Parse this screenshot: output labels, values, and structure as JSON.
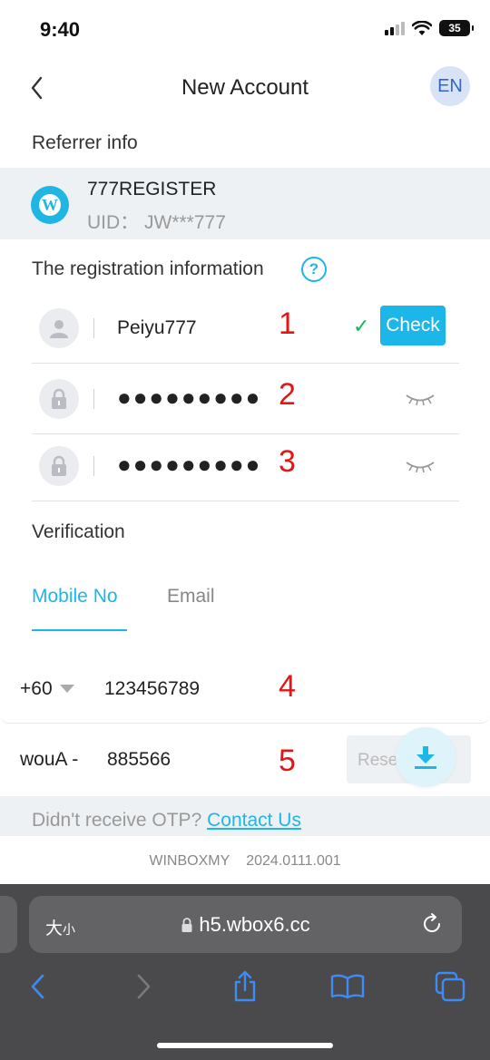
{
  "status_bar": {
    "time": "9:40",
    "battery": "35"
  },
  "header": {
    "title": "New Account",
    "language": "EN"
  },
  "referrer": {
    "section_label": "Referrer info",
    "logo_letter": "W",
    "name": "777REGISTER",
    "uid": "UID： JW***777"
  },
  "registration": {
    "section_label": "The registration information",
    "help_icon": "?",
    "username": {
      "value": "Peiyu777",
      "marker": "1",
      "check_label": "Check"
    },
    "password": {
      "value": "●●●●●●●●●",
      "marker": "2"
    },
    "confirm_password": {
      "value": "●●●●●●●●●",
      "marker": "3"
    }
  },
  "verification": {
    "section_label": "Verification",
    "tabs": [
      {
        "label": "Mobile No",
        "active": true
      },
      {
        "label": "Email",
        "active": false
      }
    ],
    "country_code": "+60",
    "phone": "123456789",
    "phone_marker": "4",
    "otp_prefix": "wouA -",
    "otp_code": "885566",
    "otp_marker": "5",
    "resend_label": "Rese"
  },
  "otp_help": {
    "text": "Didn't receive OTP?",
    "link": "Contact Us"
  },
  "footer": {
    "brand": "WINBOXMY",
    "version": "2024.0111.001"
  },
  "browser": {
    "text_size_label": "大",
    "text_size_small": "小",
    "url": "h5.wbox6.cc"
  },
  "colors": {
    "accent": "#1cb6e8",
    "marker": "#e31515",
    "success": "#19b35a"
  },
  "icons": [
    "back-chevron-icon",
    "user-icon",
    "lock-icon",
    "eye-closed-icon",
    "download-icon",
    "reload-icon",
    "share-icon",
    "bookmarks-icon",
    "tabs-icon"
  ]
}
